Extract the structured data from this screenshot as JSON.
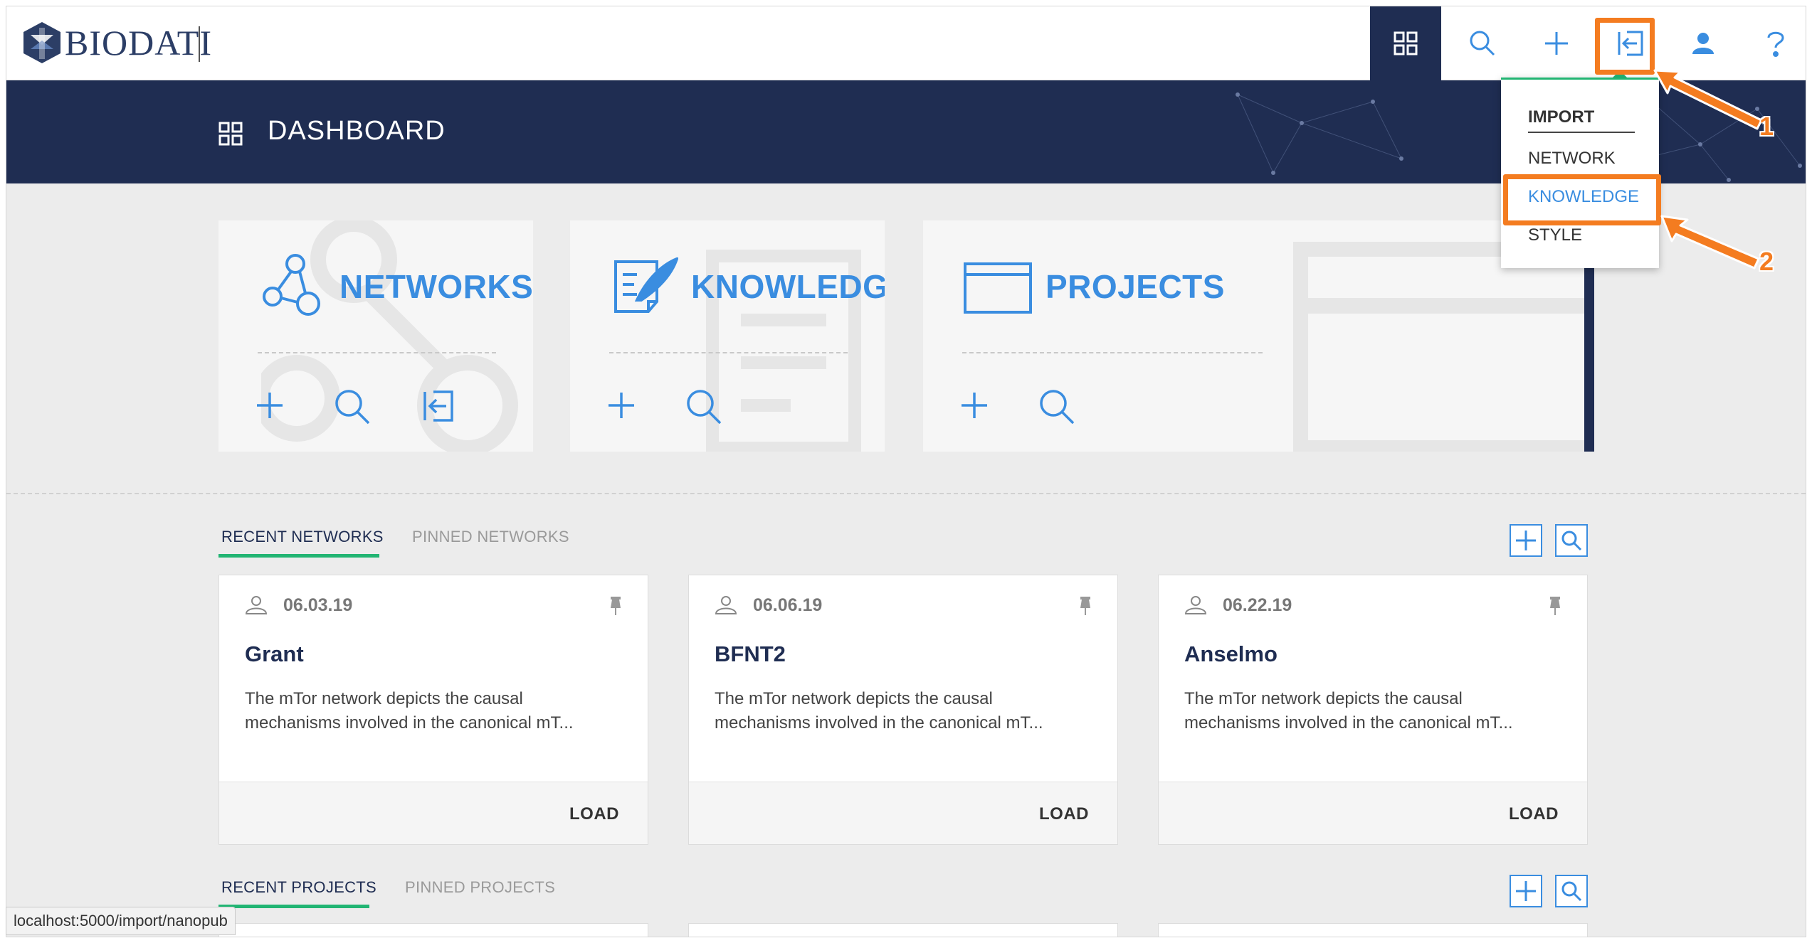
{
  "app": {
    "logo_text": "BIODATI"
  },
  "nav": {
    "buttons": [
      {
        "name": "dashboard-icon"
      },
      {
        "name": "search-icon"
      },
      {
        "name": "plus-icon"
      },
      {
        "name": "import-icon"
      },
      {
        "name": "user-icon"
      },
      {
        "name": "help-icon"
      }
    ]
  },
  "banner": {
    "title": "DASHBOARD"
  },
  "import_menu": {
    "header": "IMPORT",
    "items": [
      "NETWORK",
      "KNOWLEDGE",
      "STYLE"
    ],
    "highlighted": "KNOWLEDGE"
  },
  "annotations": {
    "step1": "1",
    "step2": "2"
  },
  "sections": {
    "networks": {
      "title": "NETWORKS"
    },
    "knowledge": {
      "title": "KNOWLEDGE"
    },
    "projects": {
      "title": "PROJECTS"
    }
  },
  "recent_networks": {
    "tabs": [
      "RECENT NETWORKS",
      "PINNED NETWORKS"
    ],
    "cards": [
      {
        "date": "06.03.19",
        "name": "Grant",
        "description": "The mTor network depicts the causal mechanisms involved in the canonical mT...",
        "action": "LOAD"
      },
      {
        "date": "06.06.19",
        "name": "BFNT2",
        "description": "The mTor network depicts the causal mechanisms involved in the canonical mT...",
        "action": "LOAD"
      },
      {
        "date": "06.22.19",
        "name": "Anselmo",
        "description": "The mTor network depicts the causal mechanisms involved in the canonical mT...",
        "action": "LOAD"
      }
    ]
  },
  "recent_projects": {
    "tabs": [
      "RECENT PROJECTS",
      "PINNED PROJECTS"
    ]
  },
  "status_bar": {
    "url": "localhost:5000/import/nanopub"
  },
  "colors": {
    "navy": "#1f2d52",
    "accent": "#3a8de0",
    "green": "#22b573",
    "orange": "#f47c20"
  }
}
